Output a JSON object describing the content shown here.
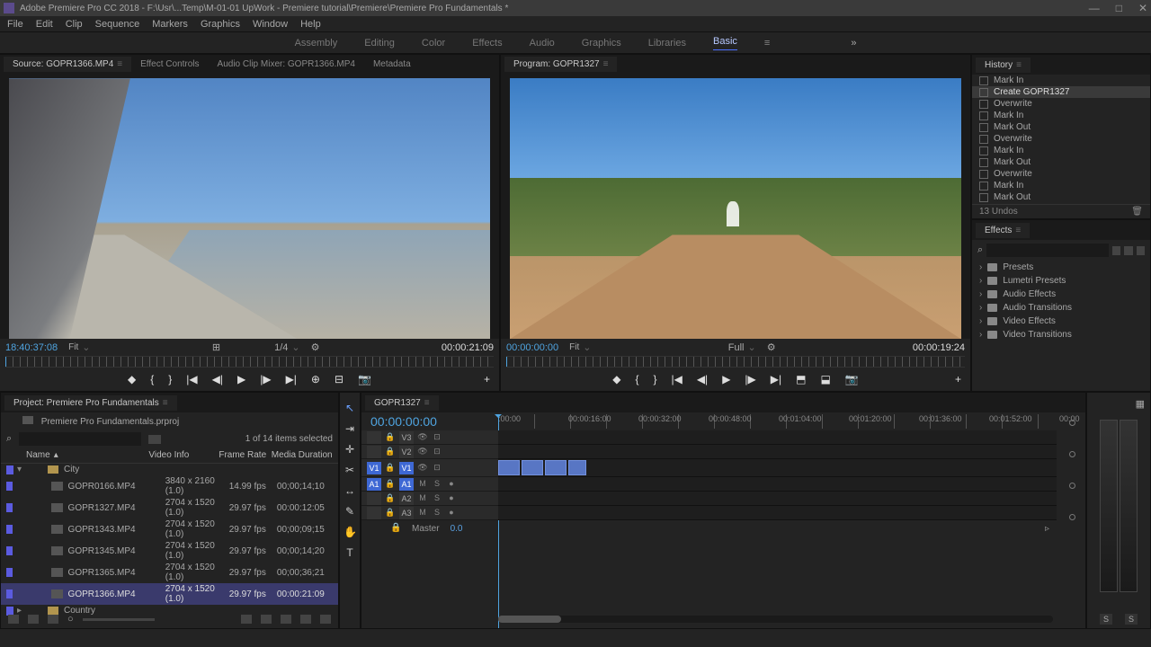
{
  "title": "Adobe Premiere Pro CC 2018 - F:\\Usr\\...Temp\\M-01-01 UpWork - Premiere tutorial\\Premiere\\Premiere Pro Fundamentals *",
  "menus": [
    "File",
    "Edit",
    "Clip",
    "Sequence",
    "Markers",
    "Graphics",
    "Window",
    "Help"
  ],
  "workspaces": {
    "items": [
      "Assembly",
      "Editing",
      "Color",
      "Effects",
      "Audio",
      "Graphics",
      "Libraries",
      "Basic"
    ],
    "active": "Basic"
  },
  "source": {
    "tabs": [
      {
        "label": "Source: GOPR1366.MP4",
        "x": "≡",
        "active": true
      },
      {
        "label": "Effect Controls"
      },
      {
        "label": "Audio Clip Mixer: GOPR1366.MP4"
      },
      {
        "label": "Metadata"
      }
    ],
    "tc_left": "18:40:37:08",
    "fit": "Fit",
    "res": "1/4",
    "tc_right": "00:00:21:09"
  },
  "program": {
    "tabs": [
      {
        "label": "Program: GOPR1327",
        "x": "≡",
        "active": true
      }
    ],
    "tc_left": "00:00:00:00",
    "fit": "Fit",
    "res": "Full",
    "tc_right": "00:00:19:24"
  },
  "history": {
    "title": "History",
    "items": [
      "Mark In",
      "Create GOPR1327",
      "Overwrite",
      "Mark In",
      "Mark Out",
      "Overwrite",
      "Mark In",
      "Mark Out",
      "Overwrite",
      "Mark In",
      "Mark Out"
    ],
    "active": 1,
    "undos": "13 Undos"
  },
  "effects": {
    "title": "Effects",
    "cats": [
      "Presets",
      "Lumetri Presets",
      "Audio Effects",
      "Audio Transitions",
      "Video Effects",
      "Video Transitions"
    ]
  },
  "project": {
    "tab": "Project: Premiere Pro Fundamentals",
    "file": "Premiere Pro Fundamentals.prproj",
    "count": "1 of 14 items selected",
    "headers": {
      "name": "Name",
      "vi": "Video Info",
      "fr": "Frame Rate",
      "md": "Media Duration"
    },
    "bins": [
      "City",
      "Country"
    ],
    "clips": [
      {
        "name": "GOPR0166.MP4",
        "vi": "3840 x 2160 (1.0)",
        "fr": "14.99 fps",
        "md": "00;00;14;10"
      },
      {
        "name": "GOPR1327.MP4",
        "vi": "2704 x 1520 (1.0)",
        "fr": "29.97 fps",
        "md": "00:00:12:05"
      },
      {
        "name": "GOPR1343.MP4",
        "vi": "2704 x 1520 (1.0)",
        "fr": "29.97 fps",
        "md": "00;00;09;15"
      },
      {
        "name": "GOPR1345.MP4",
        "vi": "2704 x 1520 (1.0)",
        "fr": "29.97 fps",
        "md": "00;00;14;20"
      },
      {
        "name": "GOPR1365.MP4",
        "vi": "2704 x 1520 (1.0)",
        "fr": "29.97 fps",
        "md": "00;00;36;21"
      },
      {
        "name": "GOPR1366.MP4",
        "vi": "2704 x 1520 (1.0)",
        "fr": "29.97 fps",
        "md": "00:00:21:09"
      }
    ],
    "selected": 5
  },
  "timeline": {
    "tab": "GOPR1327",
    "tc": "00:00:00:00",
    "markers": [
      ":00:00",
      "00:00:16:00",
      "00:00:32:00",
      "00:00:48:00",
      "00:01:04:00",
      "00:01:20:00",
      "00:01:36:00",
      "00:01:52:00",
      "00:00"
    ],
    "video_tracks": [
      "V3",
      "V2",
      "V1"
    ],
    "audio_tracks": [
      "A1",
      "A2",
      "A3"
    ],
    "master": "Master",
    "master_val": "0.0",
    "solo": "S",
    "mute": "M"
  }
}
